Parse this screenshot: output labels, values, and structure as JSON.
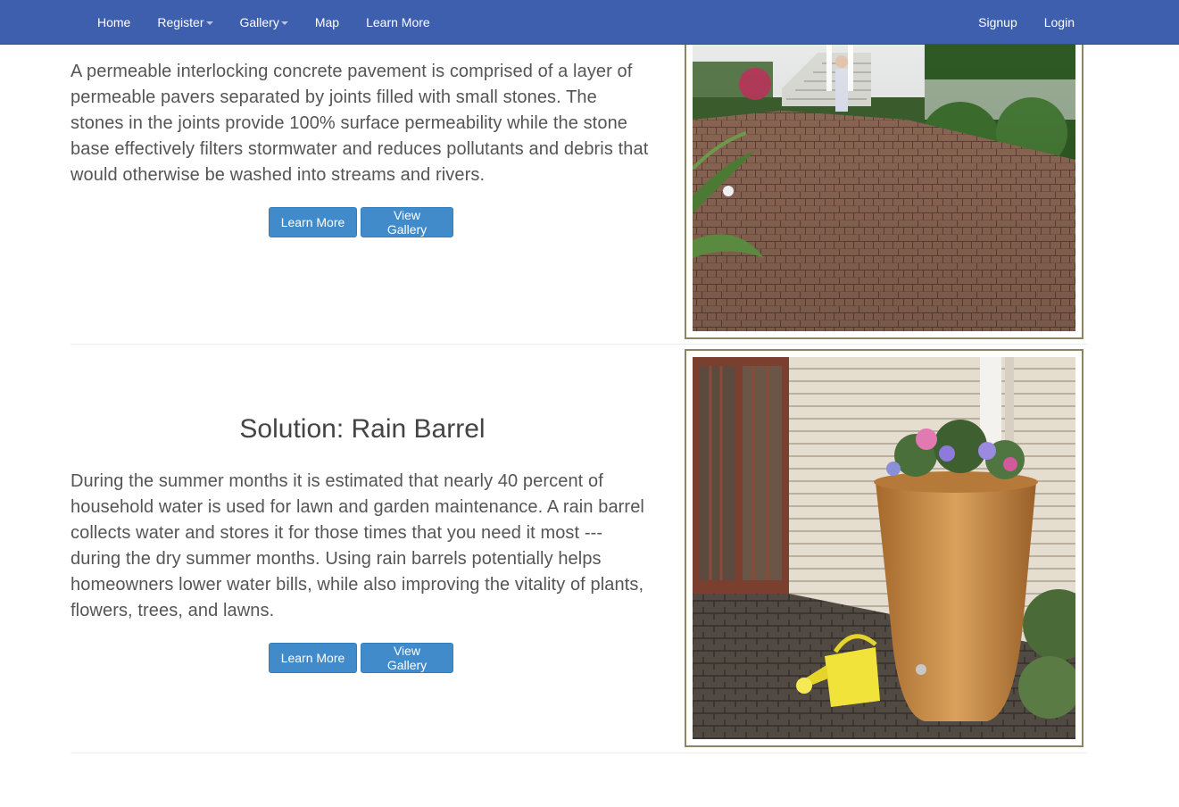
{
  "navbar": {
    "left_items": [
      {
        "label": "Home",
        "dropdown": false
      },
      {
        "label": "Register",
        "dropdown": true
      },
      {
        "label": "Gallery",
        "dropdown": true
      },
      {
        "label": "Map",
        "dropdown": false
      },
      {
        "label": "Learn More",
        "dropdown": false
      }
    ],
    "right_items": [
      {
        "label": "Signup"
      },
      {
        "label": "Login"
      }
    ],
    "background_color": "#3d5fae"
  },
  "sections": [
    {
      "heading": "",
      "paragraph": "A permeable interlocking concrete pavement is comprised of a layer of permeable pavers separated by joints filled with small stones. The stones in the joints provide 100% surface permeability while the stone base effectively filters stormwater and reduces pollutants and debris that would otherwise be washed into streams and rivers.",
      "buttons": {
        "learn_more": "Learn More",
        "view_gallery": "View Gallery"
      }
    },
    {
      "heading": "Solution: Rain Barrel",
      "paragraph": "During the summer months it is estimated that nearly 40 percent of household water is used for lawn and garden maintenance. A rain barrel collects water and stores it for those times that you need it most --- during the dry summer months. Using rain barrels potentially helps homeowners lower water bills, while also improving the vitality of plants, flowers, trees, and lawns.",
      "buttons": {
        "learn_more": "Learn More",
        "view_gallery": "View Gallery"
      }
    }
  ],
  "colors": {
    "button": "#428bca",
    "frame": "#8c8463"
  }
}
